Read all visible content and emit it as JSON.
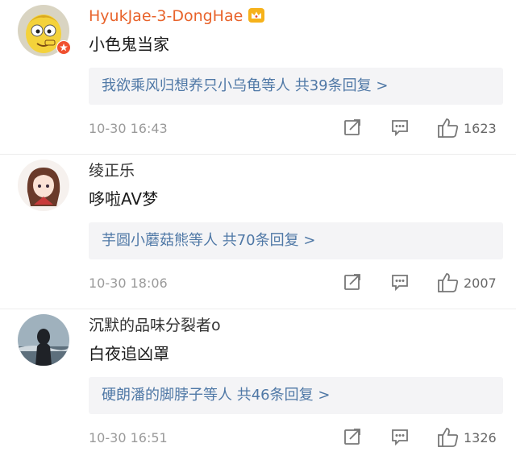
{
  "comments": [
    {
      "username": "HyukJae-3-DongHae",
      "text": "小色鬼当家",
      "reply_summary": "我欲乘风归想养只小乌龟等人 共39条回复 >",
      "timestamp": "10-30 16:43",
      "likes": "1623",
      "username_color": "#e8632b",
      "badges": [
        "vip-crown-icon",
        "verified-badge-icon"
      ]
    },
    {
      "username": "绫正乐",
      "text": "哆啦AV梦",
      "reply_summary": "芋圆小蘑菇熊等人 共70条回复 >",
      "timestamp": "10-30 18:06",
      "likes": "2007"
    },
    {
      "username": "沉默的品味分裂者o",
      "text": "白夜追凶罩",
      "reply_summary": "硬朗潘的脚脖子等人 共46条回复 >",
      "timestamp": "10-30 16:51",
      "likes": "1326"
    }
  ],
  "icons": [
    "share-icon",
    "comment-icon",
    "like-icon"
  ],
  "colors": {
    "link": "#4f78a6",
    "meta": "#9a9a9a",
    "reply_bg": "#f4f4f6"
  }
}
